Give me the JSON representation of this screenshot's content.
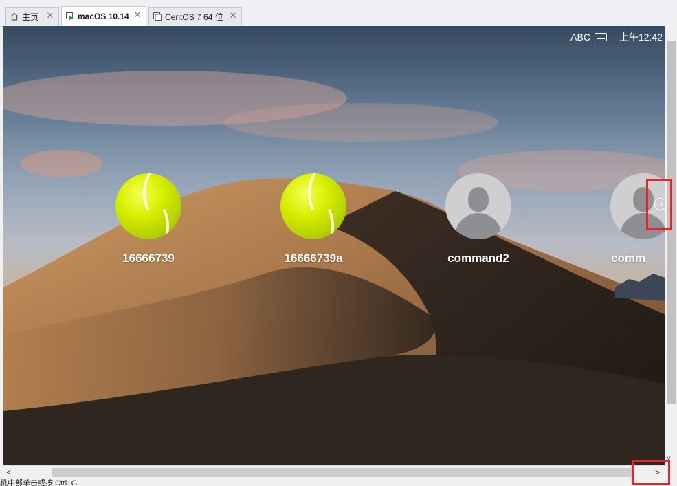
{
  "tabs": [
    {
      "label": "主页",
      "icon": "home-icon"
    },
    {
      "label": "macOS 10.14",
      "icon": "vm-running-icon"
    },
    {
      "label": "CentOS 7 64 位",
      "icon": "vm-icon"
    }
  ],
  "menubar": {
    "input_source": "ABC",
    "clock": "上午12:42"
  },
  "users": [
    {
      "name": "16666739",
      "avatar": "tennis-ball"
    },
    {
      "name": "16666739a",
      "avatar": "tennis-ball"
    },
    {
      "name": "command2",
      "avatar": "default-person"
    },
    {
      "name": "comm",
      "avatar": "default-person"
    }
  ],
  "scrollbar": {
    "left_arrow": "<",
    "right_arrow": ">",
    "down_arrow": "˅"
  },
  "status_text": "机中部单击或按 Ctrl+G",
  "colors": {
    "highlight": "#e32626"
  }
}
